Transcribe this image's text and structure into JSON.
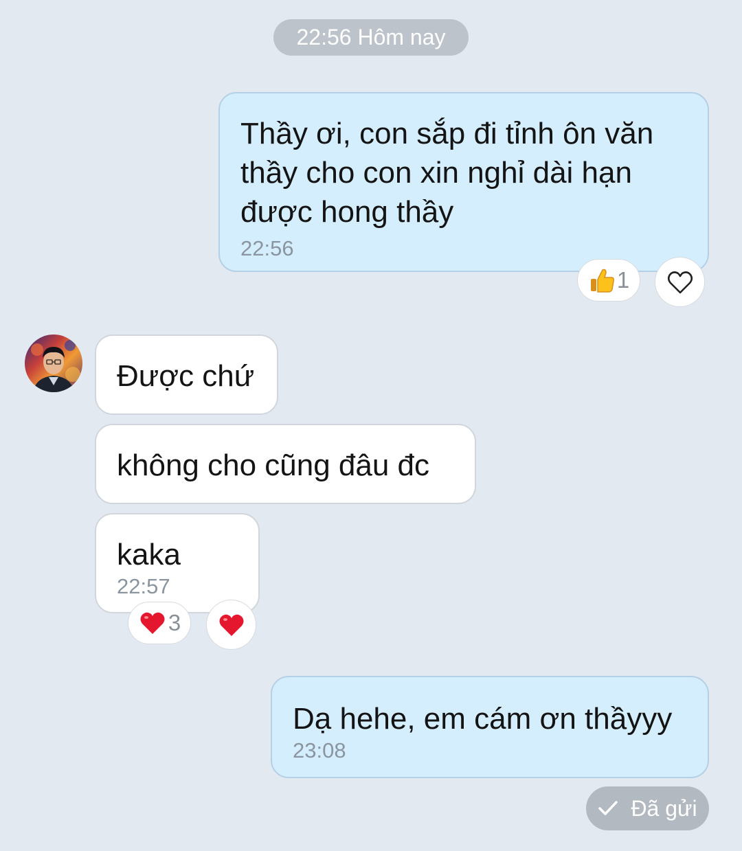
{
  "date_separator": "22:56 Hôm nay",
  "messages": [
    {
      "direction": "outgoing",
      "lines": [
        "Thầy ơi, con sắp đi tỉnh ôn văn",
        "thầy cho con xin nghỉ dài hạn",
        "được hong thầy"
      ],
      "time": "22:56",
      "reactions": [
        {
          "icon": "thumbs-up-icon",
          "count": "1"
        }
      ],
      "react_button_icon": "heart-outline-icon"
    },
    {
      "direction": "incoming",
      "text": "Được chứ"
    },
    {
      "direction": "incoming",
      "text": "không cho cũng đâu đc"
    },
    {
      "direction": "incoming",
      "text": "kaka",
      "time": "22:57",
      "reactions": [
        {
          "icon": "red-heart-icon",
          "count": "3"
        }
      ],
      "react_button_icon": "red-heart-icon"
    },
    {
      "direction": "outgoing",
      "text": "Dạ hehe, em cám ơn thầyyy",
      "time": "23:08"
    }
  ],
  "status": {
    "icon": "check-icon",
    "label": "Đã gửi"
  },
  "colors": {
    "background": "#e2e9f1",
    "outgoing_bubble": "#d5eefd",
    "incoming_bubble": "#ffffff",
    "heart": "#e4172f"
  }
}
